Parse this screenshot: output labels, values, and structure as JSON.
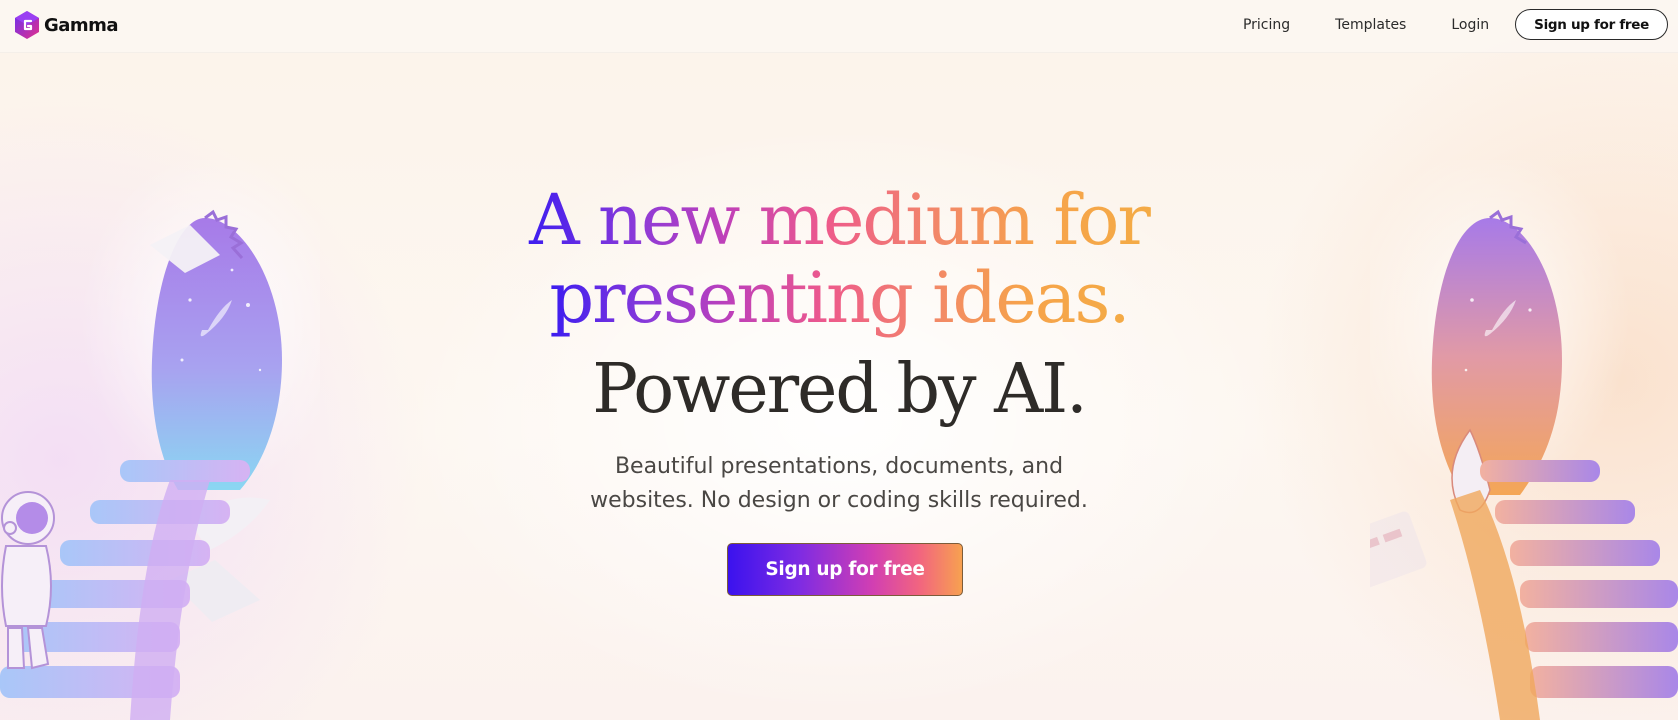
{
  "brand": {
    "name": "Gamma"
  },
  "nav": {
    "items": [
      {
        "label": "Pricing"
      },
      {
        "label": "Templates"
      },
      {
        "label": "Login"
      }
    ],
    "signup_label": "Sign up for free"
  },
  "hero": {
    "headline_gradient_1": "A new medium for",
    "headline_gradient_2": "presenting ideas.",
    "headline_dark": "Powered by AI.",
    "subtitle_line_1": "Beautiful presentations, documents, and",
    "subtitle_line_2": "websites. No design or coding skills required.",
    "cta_label": "Sign up for free"
  },
  "colors": {
    "gradient_start": "#3b12ee",
    "gradient_mid": "#ee5a8b",
    "gradient_end": "#f7a150",
    "text_dark": "#2e2b28"
  },
  "icons": [
    "gamma-logo-icon"
  ],
  "illustrations": [
    "left-portal-illustration",
    "right-portal-illustration",
    "astronaut-illustration"
  ]
}
